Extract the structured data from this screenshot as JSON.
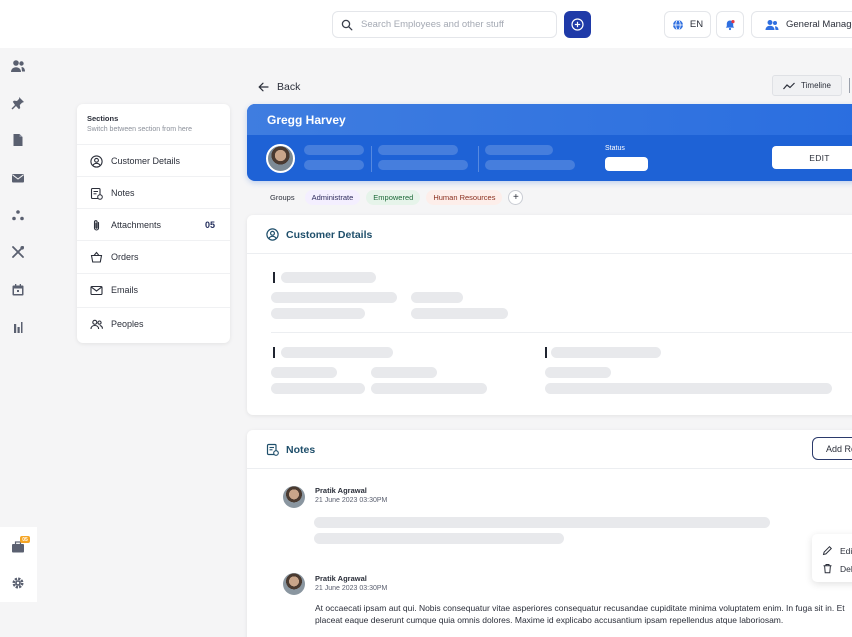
{
  "topbar": {
    "search_placeholder": "Search Employees and other stuff",
    "language": "EN",
    "user_role": "General Manager"
  },
  "rail": {
    "icons": [
      "people-icon",
      "pin-icon",
      "document-icon",
      "mail-icon",
      "network-icon",
      "tools-icon",
      "calendar-icon",
      "report-icon"
    ],
    "bottom_icons": [
      "briefcase-icon",
      "settings-icon"
    ],
    "badge": "05"
  },
  "sections": {
    "title": "Sections",
    "subtitle": "Switch between section from here",
    "items": [
      {
        "label": "Customer Details",
        "icon": "user-circle-icon"
      },
      {
        "label": "Notes",
        "icon": "note-icon"
      },
      {
        "label": "Attachments",
        "icon": "paperclip-icon",
        "count": "05"
      },
      {
        "label": "Orders",
        "icon": "basket-icon"
      },
      {
        "label": "Emails",
        "icon": "mail-icon"
      },
      {
        "label": "Peoples",
        "icon": "people-icon"
      }
    ]
  },
  "nav": {
    "back_label": "Back",
    "timeline_label": "Timeline"
  },
  "profile": {
    "name": "Gregg Harvey",
    "status_label": "Status",
    "edit_label": "EDIT"
  },
  "groups": {
    "label": "Groups",
    "chips": [
      "Administrate",
      "Empowered",
      "Human Resources"
    ],
    "add_label": "+"
  },
  "customer_details": {
    "title": "Customer Details"
  },
  "notes": {
    "title": "Notes",
    "add_label": "Add Reply",
    "items": [
      {
        "author": "Pratik Agrawal",
        "date": "21 June 2023  03:30PM"
      },
      {
        "author": "Pratik Agrawal",
        "date": "21 June 2023  03:30PM",
        "text": "At occaecati ipsam aut qui. Nobis consequatur vitae asperiores consequatur recusandae cupiditate minima voluptatem enim. In fuga sit in. Et placeat eaque deserunt cumque quia omnis dolores. Maxime id explicabo accusantium ipsam repellendus atque laboriosam."
      }
    ],
    "menu": {
      "edit_label": "Edit",
      "delete_label": "Delete"
    }
  },
  "colors": {
    "primary": "#1f3aa8",
    "hero": "#1e62d6",
    "accent_badge": "#f5a524"
  }
}
